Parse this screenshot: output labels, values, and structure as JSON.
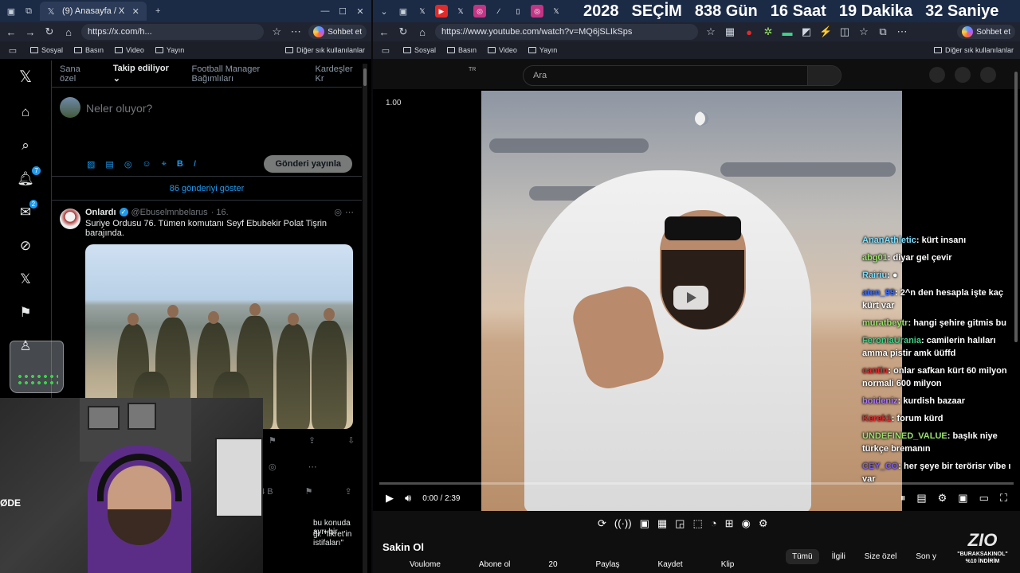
{
  "left_browser": {
    "tab_title": "(9) Anasayfa / X",
    "url": "https://x.com/h...",
    "chat_button": "Sohbet et",
    "favorites": [
      "Sosyal",
      "Basın",
      "Video",
      "Yayın"
    ],
    "favorites_more": "Diğer sık kullanılanlar"
  },
  "x": {
    "notif_badge": "7",
    "msg_badge": "2",
    "tabs": [
      "Sana özel",
      "Takip ediliyor",
      "Football Manager Bağımlıları",
      "Kardeşler Kr"
    ],
    "compose_placeholder": "Neler oluyor?",
    "post_button": "Gönderi yayınla",
    "show_more": "86 gönderiyi göster",
    "tweet": {
      "name": "Onlardı",
      "handle": "@Ebuselmnbelarus",
      "time": "· 16.",
      "text": "Suriye Ordusu 76. Tümen komutanı Seyf Ebubekir Polat Tişrin barajında."
    },
    "second_views": "4 B",
    "partial_text_1": "bu konuda ayrı bir",
    "partial_text_2": "ği: \"fikret'in istifaları\""
  },
  "webcam": {
    "logo_text": "ØDE"
  },
  "right_browser": {
    "countdown": [
      "2028",
      "SEÇİM",
      "838 Gün",
      "16 Saat",
      "19 Dakika",
      "32 Saniye"
    ],
    "url": "https://www.youtube.com/watch?v=MQ6jSLIkSps",
    "chat_button": "Sohbet et",
    "favorites": [
      "Sosyal",
      "Basın",
      "Video",
      "Yayın"
    ],
    "favorites_more": "Diğer sık kullanılanlar"
  },
  "youtube": {
    "country": "TR",
    "search_placeholder": "Ara",
    "speed": "1.00",
    "time": "0:00 / 2:39",
    "title": "Sakin Ol",
    "row": [
      "Voulome",
      "Abone ol",
      "20",
      "Paylaş",
      "Kaydet",
      "Klip"
    ],
    "chips": [
      "Tümü",
      "İlgili",
      "Size özel",
      "Son y"
    ]
  },
  "chat_messages": [
    {
      "user": "AnanAthletic",
      "color": "#7ee0ff",
      "text": "kürt insanı"
    },
    {
      "user": "abg01",
      "color": "#9be36a",
      "text": "diyar gel çevir"
    },
    {
      "user": "Rairiu",
      "color": "#7ee0ff",
      "text": "●"
    },
    {
      "user": "aten_99",
      "color": "#3b6cff",
      "text": "2^n den hesapla işte kaç kürt var"
    },
    {
      "user": "muratbeytr",
      "color": "#9be36a",
      "text": "hangi şehire gitmis bu"
    },
    {
      "user": "FeroniaUrania",
      "color": "#3fd28a",
      "text": "camilerin halıları amma pistir amk üüffd"
    },
    {
      "user": "cantin",
      "color": "#e02b2b",
      "text": "onlar safkan kürt 60 milyon normali 600 milyon"
    },
    {
      "user": "boideniz",
      "color": "#b07cff",
      "text": "kurdish bazaar"
    },
    {
      "user": "Kerek1",
      "color": "#e02b2b",
      "text": "forum kürd"
    },
    {
      "user": "UNDEFINED_VALUE",
      "color": "#9be36a",
      "text": "başlık niye türkçe bremanın"
    },
    {
      "user": "CEY_CO",
      "color": "#7d5cff",
      "text": "her şeye bir terörisr vibe ı var"
    }
  ],
  "zio": {
    "brand": "ZIO",
    "promo_1": "\"BURAKSAKINOL\"",
    "promo_2": "%10 İNDİRİM"
  },
  "colors": {
    "x_blue": "#1d9bf0",
    "yt_bg": "#0f0f0f",
    "tabbar": "#1b2a45"
  }
}
